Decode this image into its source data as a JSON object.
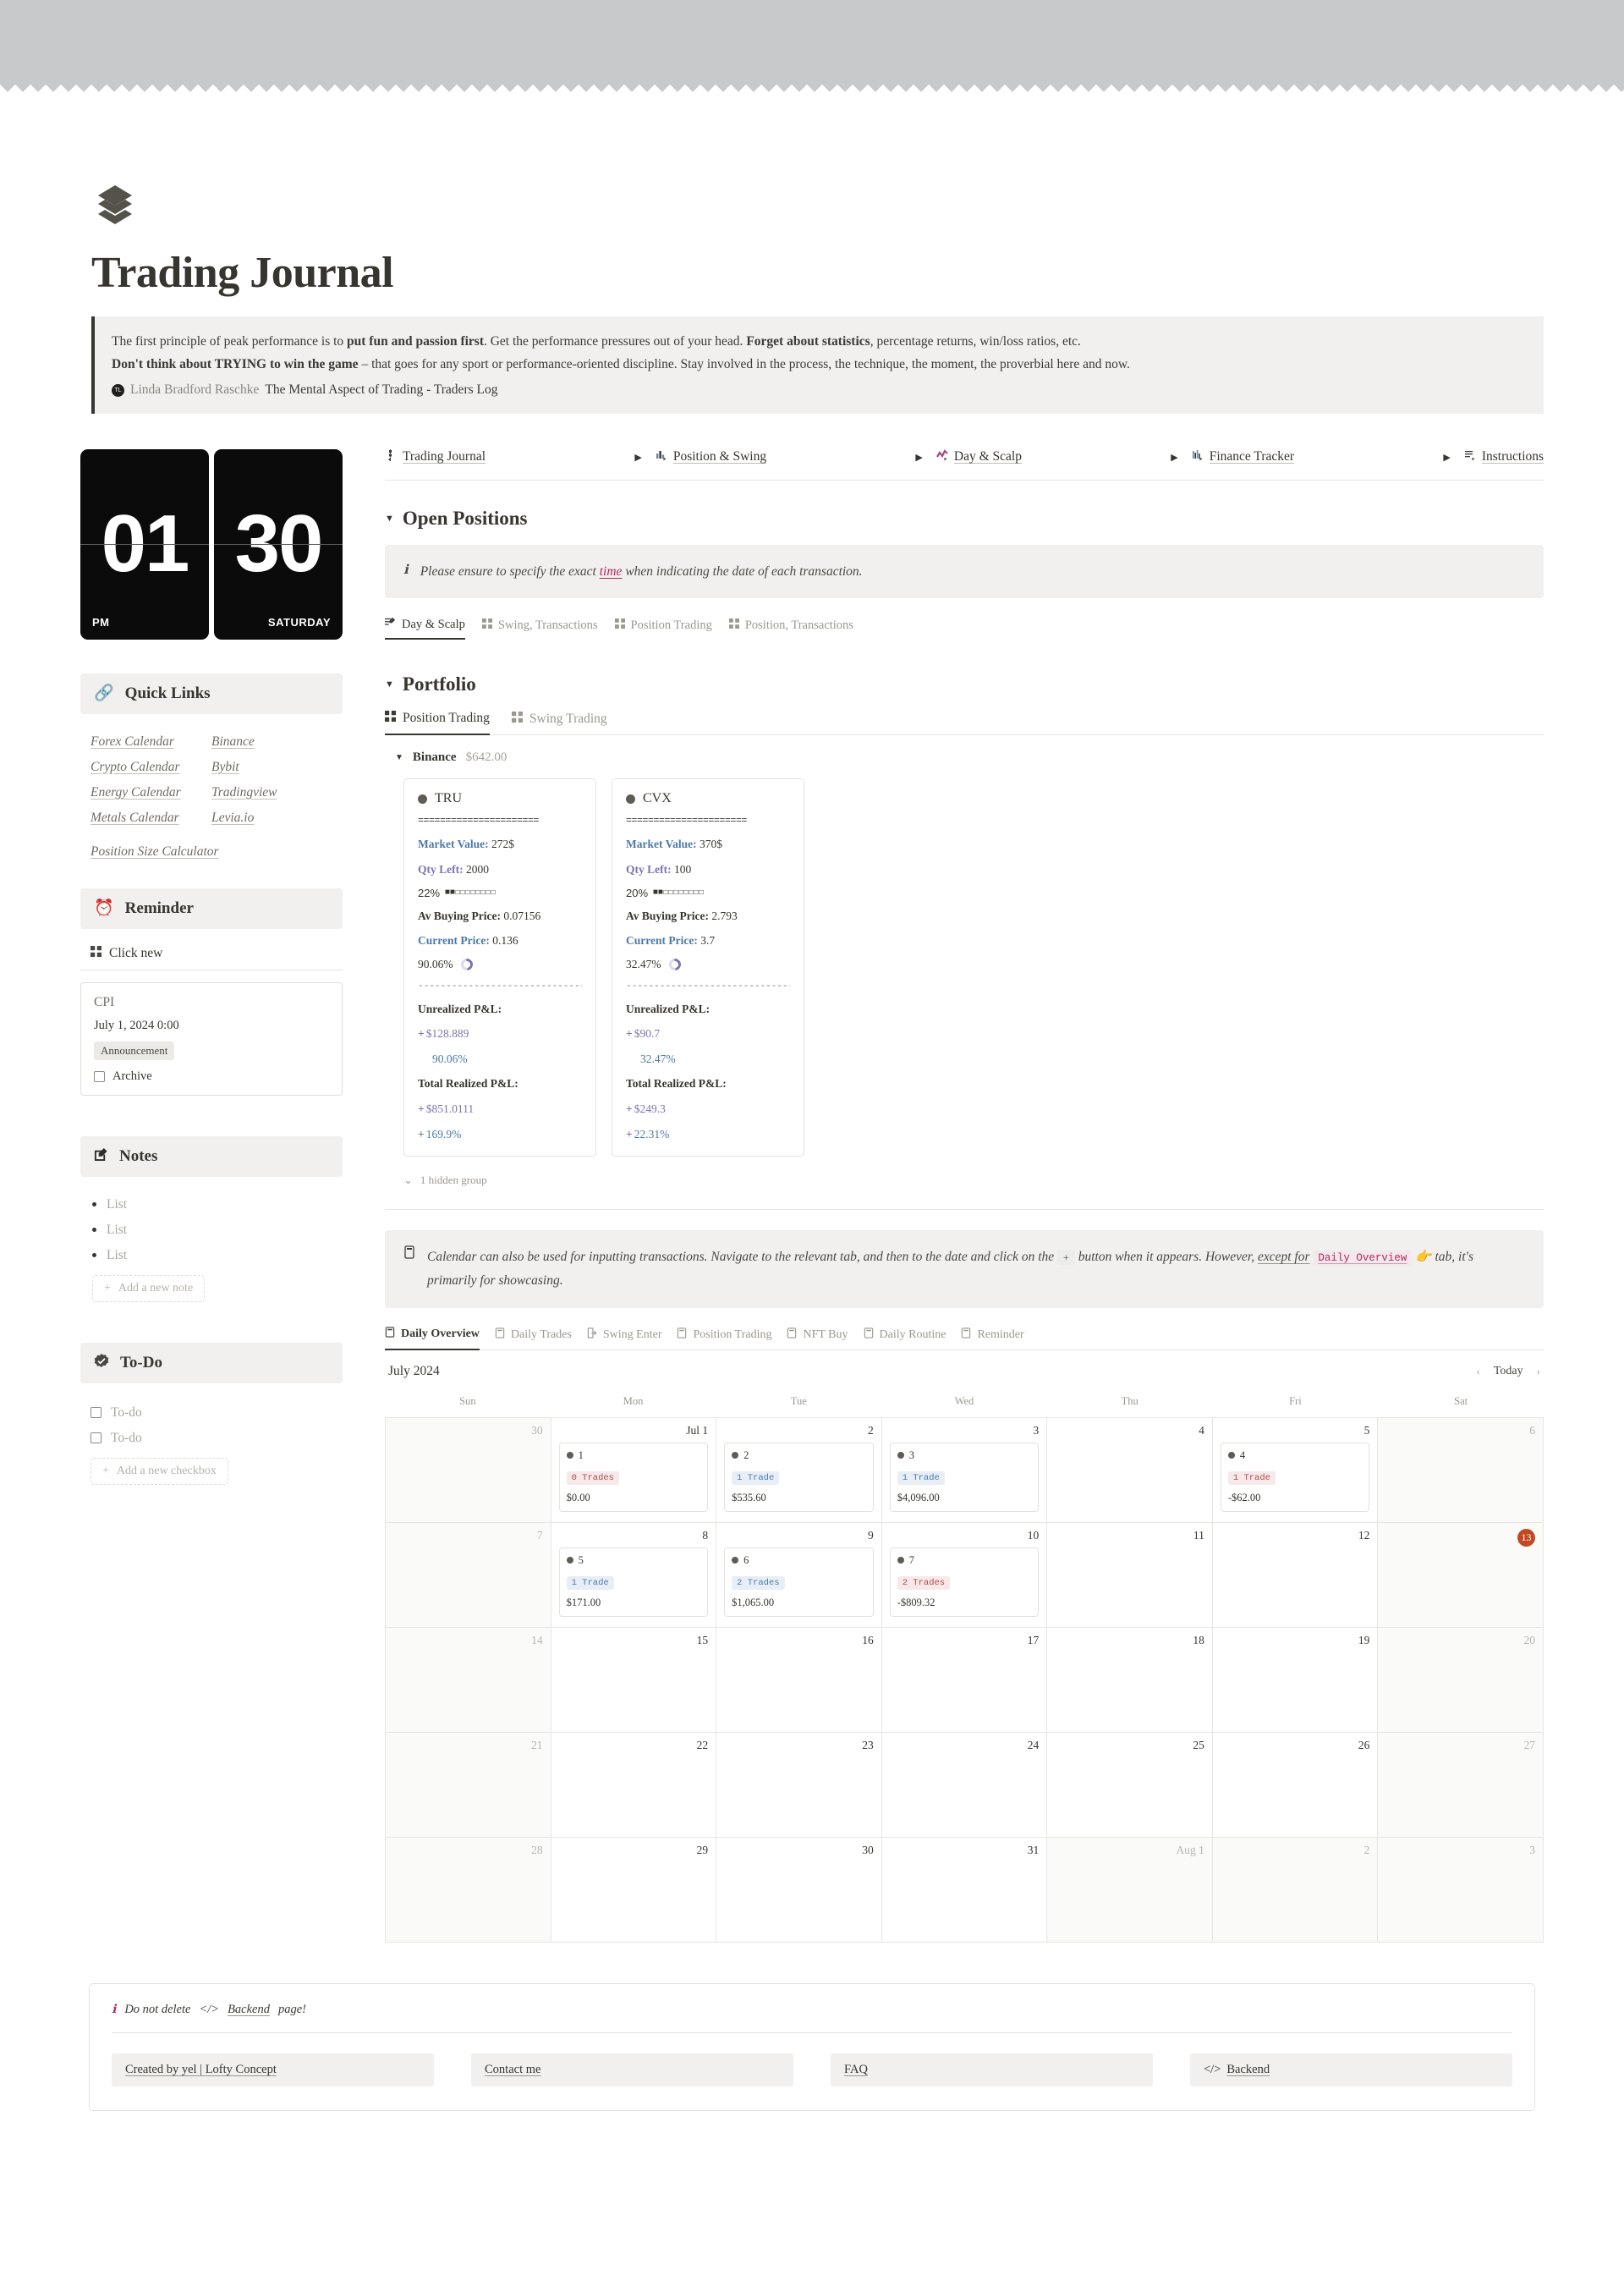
{
  "header": {
    "logo_icon": "layers-stack-icon",
    "title": "Trading Journal",
    "quote_line1_a": "The first principle of peak performance is to ",
    "quote_line1_b": "put fun and passion first",
    "quote_line1_c": ". Get the performance pressures out of your head. ",
    "quote_line1_d": "Forget about statistics",
    "quote_line1_e": ", percentage returns, win/loss ratios, etc.",
    "quote_line2_a": "Don't think about TRYING to win the game",
    "quote_line2_b": " – that goes for any sport or performance-oriented discipline. Stay involved in the process, the technique, the moment, the proverbial here and now.",
    "attr_avatar": "TL",
    "attr_name": "Linda Bradford Raschke",
    "attr_source": "The Mental Aspect of Trading - Traders Log"
  },
  "clock": {
    "hour": "01",
    "minute": "30",
    "meridiem": "PM",
    "weekday": "SATURDAY"
  },
  "nav": {
    "items": [
      {
        "label": "Trading Journal",
        "icon": "candlestick-icon",
        "has_arrow": false
      },
      {
        "label": "Position & Swing",
        "icon": "bar-chart-icon",
        "has_arrow": true
      },
      {
        "label": "Day & Scalp",
        "icon": "zigzag-chart-icon",
        "has_arrow": true
      },
      {
        "label": "Finance Tracker",
        "icon": "column-chart-icon",
        "has_arrow": true
      },
      {
        "label": "Instructions",
        "icon": "list-lines-icon",
        "has_arrow": true
      }
    ]
  },
  "quick_links": {
    "heading": "Quick Links",
    "icon": "link-chain-icon",
    "left": [
      "Forex Calendar",
      "Crypto Calendar",
      "Energy Calendar",
      "Metals Calendar"
    ],
    "right": [
      "Binance",
      "Bybit",
      "Tradingview",
      "Levia.io"
    ],
    "full_width": "Position Size Calculator"
  },
  "reminder": {
    "heading": "Reminder",
    "icon": "alarm-clock-icon",
    "click_new": "Click new",
    "click_new_icon": "grid-icon",
    "card": {
      "title": "CPI",
      "date": "July 1, 2024 0:00",
      "tag": "Announcement",
      "checkbox_label": "Archive"
    }
  },
  "notes": {
    "heading": "Notes",
    "icon": "pencil-square-icon",
    "items": [
      "List",
      "List",
      "List"
    ],
    "add_label": "Add a new note"
  },
  "todo": {
    "heading": "To-Do",
    "icon": "check-badge-icon",
    "items": [
      "To-do",
      "To-do"
    ],
    "add_label": "Add a new checkbox"
  },
  "open_positions": {
    "heading": "Open Positions",
    "callout_pre": "Please ensure to specify the exact ",
    "callout_hl": "time",
    "callout_post": " when indicating the date of each transaction.",
    "tabs": [
      {
        "label": "Day & Scalp",
        "icon": "list-pencil-icon",
        "active": true
      },
      {
        "label": "Swing, Transactions",
        "icon": "grid-icon",
        "active": false
      },
      {
        "label": "Position Trading",
        "icon": "grid-icon",
        "active": false
      },
      {
        "label": "Position, Transactions",
        "icon": "grid-icon",
        "active": false
      }
    ]
  },
  "portfolio": {
    "heading": "Portfolio",
    "tabs": [
      {
        "label": "Position Trading",
        "icon": "grid-icon",
        "active": true
      },
      {
        "label": "Swing Trading",
        "icon": "grid-icon",
        "active": false
      }
    ],
    "group": {
      "name": "Binance",
      "value": "$642.00"
    },
    "cards": [
      {
        "ticker": "TRU",
        "divider_eq": "======================",
        "market_value_label": "Market Value:",
        "market_value": "272$",
        "qty_label": "Qty Left:",
        "qty": "2000",
        "pct_filled": "22%",
        "bar_filled": 2,
        "bar_empty": 8,
        "avg_price_label": "Av Buying Price:",
        "avg_price": "0.07156",
        "current_price_label": "Current Price:",
        "current_price": "0.136",
        "ring_pct": "90.06%",
        "divider_dash": "-----------------------------------",
        "unrealized_label": "Unrealized P&L:",
        "unrealized_amount": "$128.889",
        "unrealized_pct": "90.06%",
        "realized_label": "Total Realized P&L:",
        "realized_amount": "$851.0111",
        "realized_pct": "169.9%"
      },
      {
        "ticker": "CVX",
        "divider_eq": "======================",
        "market_value_label": "Market Value:",
        "market_value": "370$",
        "qty_label": "Qty Left:",
        "qty": "100",
        "pct_filled": "20%",
        "bar_filled": 2,
        "bar_empty": 8,
        "avg_price_label": "Av Buying Price:",
        "avg_price": "2.793",
        "current_price_label": "Current Price:",
        "current_price": "3.7",
        "ring_pct": "32.47%",
        "divider_dash": "-----------------------------------",
        "unrealized_label": "Unrealized P&L:",
        "unrealized_amount": "$90.7",
        "unrealized_pct": "32.47%",
        "realized_label": "Total Realized P&L:",
        "realized_amount": "$249.3",
        "realized_pct": "22.31%"
      }
    ],
    "hidden_group": "1 hidden group"
  },
  "calendar_callout": {
    "icon": "calendar-icon",
    "text_a": "Calendar can also be used for inputting transactions. Navigate to the relevant tab, and then to the date and click on the ",
    "plus_key": "+",
    "text_b": " button when it appears. However, ",
    "except_for": "except for",
    "code_chip": "Daily Overview",
    "hand_icon": "pointing-hand-icon",
    "text_c": "tab, it's primarily for showcasing."
  },
  "calendar": {
    "tabs": [
      {
        "label": "Daily Overview",
        "icon": "calendar-icon",
        "active": true
      },
      {
        "label": "Daily Trades",
        "icon": "calendar-icon",
        "active": false
      },
      {
        "label": "Swing Enter",
        "icon": "enter-arrow-icon",
        "active": false
      },
      {
        "label": "Position Trading",
        "icon": "calendar-icon",
        "active": false
      },
      {
        "label": "NFT Buy",
        "icon": "calendar-icon",
        "active": false
      },
      {
        "label": "Daily Routine",
        "icon": "calendar-icon",
        "active": false
      },
      {
        "label": "Reminder",
        "icon": "calendar-icon",
        "active": false
      }
    ],
    "month_label": "July 2024",
    "today_label": "Today",
    "prev_icon": "chevron-left-icon",
    "next_icon": "chevron-right-icon",
    "dow": [
      "Sun",
      "Mon",
      "Tue",
      "Wed",
      "Thu",
      "Fri",
      "Sat"
    ],
    "weeks": [
      [
        {
          "day": "30",
          "muted": true
        },
        {
          "day": "Jul 1",
          "muted": false,
          "event": {
            "title": "1",
            "badge": "0 Trades",
            "badge_color": "red",
            "amount": "$0.00"
          }
        },
        {
          "day": "2",
          "muted": false,
          "event": {
            "title": "2",
            "badge": "1 Trade",
            "badge_color": "blue",
            "amount": "$535.60"
          }
        },
        {
          "day": "3",
          "muted": false,
          "event": {
            "title": "3",
            "badge": "1 Trade",
            "badge_color": "blue",
            "amount": "$4,096.00"
          }
        },
        {
          "day": "4",
          "muted": false
        },
        {
          "day": "5",
          "muted": false,
          "event": {
            "title": "4",
            "badge": "1 Trade",
            "badge_color": "red",
            "amount": "-$62.00"
          }
        },
        {
          "day": "6",
          "muted": true
        }
      ],
      [
        {
          "day": "7",
          "muted": true
        },
        {
          "day": "8",
          "muted": false,
          "event": {
            "title": "5",
            "badge": "1 Trade",
            "badge_color": "blue",
            "amount": "$171.00"
          }
        },
        {
          "day": "9",
          "muted": false,
          "event": {
            "title": "6",
            "badge": "2 Trades",
            "badge_color": "blue",
            "amount": "$1,065.00"
          }
        },
        {
          "day": "10",
          "muted": false,
          "event": {
            "title": "7",
            "badge": "2 Trades",
            "badge_color": "red",
            "amount": "-$809.32"
          }
        },
        {
          "day": "11",
          "muted": false
        },
        {
          "day": "12",
          "muted": false
        },
        {
          "day": "13",
          "muted": true,
          "today": true
        }
      ],
      [
        {
          "day": "14",
          "muted": true
        },
        {
          "day": "15",
          "muted": false
        },
        {
          "day": "16",
          "muted": false
        },
        {
          "day": "17",
          "muted": false
        },
        {
          "day": "18",
          "muted": false
        },
        {
          "day": "19",
          "muted": false
        },
        {
          "day": "20",
          "muted": true
        }
      ],
      [
        {
          "day": "21",
          "muted": true
        },
        {
          "day": "22",
          "muted": false
        },
        {
          "day": "23",
          "muted": false
        },
        {
          "day": "24",
          "muted": false
        },
        {
          "day": "25",
          "muted": false
        },
        {
          "day": "26",
          "muted": false
        },
        {
          "day": "27",
          "muted": true
        }
      ],
      [
        {
          "day": "28",
          "muted": true
        },
        {
          "day": "29",
          "muted": false
        },
        {
          "day": "30",
          "muted": false
        },
        {
          "day": "31",
          "muted": false
        },
        {
          "day": "Aug 1",
          "muted": true
        },
        {
          "day": "2",
          "muted": true
        },
        {
          "day": "3",
          "muted": true
        }
      ]
    ]
  },
  "footer": {
    "note_icon": "info-circle-icon",
    "note_a": "Do not delete ",
    "note_code_icon": "code-icon",
    "note_link": "Backend",
    "note_b": " page!",
    "links": [
      {
        "label": "Created by yel | Lofty Concept",
        "icon": null
      },
      {
        "label": "Contact me",
        "icon": null
      },
      {
        "label": "FAQ",
        "icon": null
      },
      {
        "label": "Backend",
        "icon": "code-icon"
      }
    ]
  },
  "colors": {
    "accent_pink": "#b5275e",
    "blue": "#4b7aab",
    "purple": "#7e74ae",
    "today_orange": "#c24a22",
    "band_gray": "#c7c9ca"
  }
}
